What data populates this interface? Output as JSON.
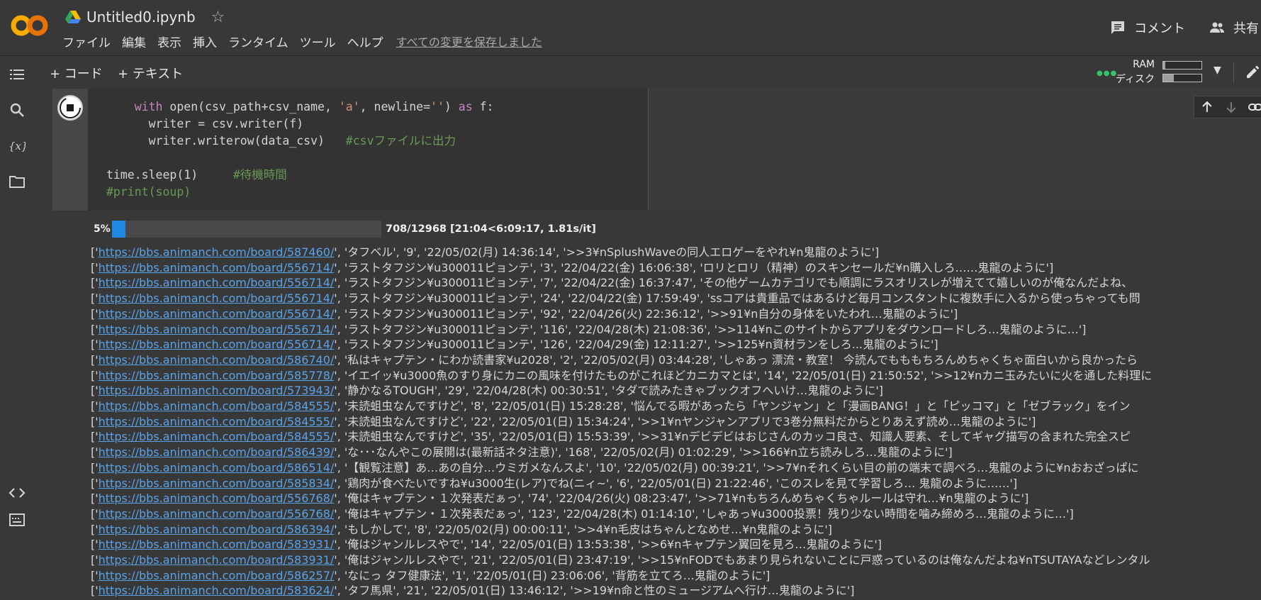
{
  "header": {
    "doc_title": "Untitled0.ipynb",
    "menu": [
      "ファイル",
      "編集",
      "表示",
      "挿入",
      "ランタイム",
      "ツール",
      "ヘルプ"
    ],
    "save_status": "すべての変更を保存しました",
    "comment_label": "コメント",
    "share_label": "共有"
  },
  "toolbar": {
    "add_code": "+ コード",
    "add_text": "+ テキスト",
    "ram_label": "RAM",
    "disk_label": "ディスク",
    "ram_fraction": 0.05,
    "disk_fraction": 0.28
  },
  "cell": {
    "code_lines": [
      {
        "indent": "    ",
        "parts": [
          [
            "kw",
            "with"
          ],
          [
            "",
            " open(csv_path+csv_name, "
          ],
          [
            "str",
            "'a'"
          ],
          [
            "",
            ", newline="
          ],
          [
            "str",
            "''"
          ],
          [
            "",
            ") "
          ],
          [
            "kw",
            "as"
          ],
          [
            "",
            " f:"
          ]
        ]
      },
      {
        "indent": "      ",
        "parts": [
          [
            "",
            "writer = csv.writer(f)"
          ]
        ]
      },
      {
        "indent": "      ",
        "parts": [
          [
            "",
            "writer.writerow(data_csv)   "
          ],
          [
            "cmt",
            "#csvファイルに出力"
          ]
        ]
      },
      {
        "indent": "",
        "parts": [
          [
            "",
            ""
          ]
        ]
      },
      {
        "indent": "",
        "parts": [
          [
            "",
            "time.sleep(1)     "
          ],
          [
            "cmt",
            "#待機時間"
          ]
        ]
      },
      {
        "indent": "",
        "parts": [
          [
            "cmt",
            "#print(soup)"
          ]
        ]
      }
    ]
  },
  "output": {
    "progress_percent": "5%",
    "progress_fraction": 0.05,
    "progress_stats": "708/12968 [21:04<6:09:17, 1.81s/it]",
    "lines": [
      {
        "url": "https://bbs.animanch.com/board/587460/",
        "rest": "', 'タフベル', '9', '22/05/02(月) 14:36:14', '>>3¥nSplushWaveの同人エロゲーをやれ¥n鬼龍のように']"
      },
      {
        "url": "https://bbs.animanch.com/board/556714/",
        "rest": "', 'ラストタフジン¥u300011ピョンテ', '3', '22/04/22(金) 16:06:38', 'ロリとロリ（精神）のスキンセールだ¥n購入しろ……鬼龍のように']"
      },
      {
        "url": "https://bbs.animanch.com/board/556714/",
        "rest": "', 'ラストタフジン¥u300011ピョンテ', '7', '22/04/22(金) 16:37:47', 'その他ゲームカテゴリでも順調にラスオリスレが増えてて嬉しいのが俺なんだよね、"
      },
      {
        "url": "https://bbs.animanch.com/board/556714/",
        "rest": "', 'ラストタフジン¥u300011ピョンテ', '24', '22/04/22(金) 17:59:49', 'ssコアは貴重品ではあるけど毎月コンスタントに複数手に入るから使っちゃっても問"
      },
      {
        "url": "https://bbs.animanch.com/board/556714/",
        "rest": "', 'ラストタフジン¥u300011ピョンテ', '92', '22/04/26(火) 22:36:12', '>>91¥n自分の身体をいたわれ…鬼龍のように']"
      },
      {
        "url": "https://bbs.animanch.com/board/556714/",
        "rest": "', 'ラストタフジン¥u300011ピョンテ', '116', '22/04/28(木) 21:08:36', '>>114¥nこのサイトからアプリをダウンロードしろ…鬼龍のように…']"
      },
      {
        "url": "https://bbs.animanch.com/board/556714/",
        "rest": "', 'ラストタフジン¥u300011ピョンテ', '126', '22/04/29(金) 12:11:27', '>>125¥n資材ランをしろ...鬼龍のように']"
      },
      {
        "url": "https://bbs.animanch.com/board/586740/",
        "rest": "', '私はキャプテン・にわか読書家¥u2028', '2', '22/05/02(月) 03:44:28', 'しゃあっ 漂流・教室！ 今読んでもももちろんめちゃくちゃ面白いから良かったら"
      },
      {
        "url": "https://bbs.animanch.com/board/585778/",
        "rest": "', 'イエイッ¥u3000魚のすり身にカニの風味を付けたものがこれほどカニカマとは', '14', '22/05/01(日) 21:50:52', '>>12¥nカニ玉みたいに火を通した料理に"
      },
      {
        "url": "https://bbs.animanch.com/board/573943/",
        "rest": "', '静かなるTOUGH', '29', '22/04/28(木) 00:30:51', 'タダで読みたきゃブックオフへいけ…鬼龍のように']"
      },
      {
        "url": "https://bbs.animanch.com/board/584555/",
        "rest": "', '未読蛆虫なんですけど', '8', '22/05/01(日) 15:28:28', '悩んでる暇があったら「ヤンジャン」と「漫画BANG！」と「ピッコマ」と「ゼブラック」をイン"
      },
      {
        "url": "https://bbs.animanch.com/board/584555/",
        "rest": "', '未読蛆虫なんですけど', '22', '22/05/01(日) 15:34:24', '>>1¥nヤンジャンアプリで3巻分無料だからとりあえず読め…鬼龍のように']"
      },
      {
        "url": "https://bbs.animanch.com/board/584555/",
        "rest": "', '未読蛆虫なんですけど', '35', '22/05/01(日) 15:53:39', '>>31¥nデビデビはおじさんのカッコ良さ、知識人要素、そしてギャグ描写の含まれた完全スピ"
      },
      {
        "url": "https://bbs.animanch.com/board/586439/",
        "rest": "', 'な･･･なんやこの展開は(最新話ネタ注意)', '168', '22/05/02(月) 01:02:29', '>>166¥n立ち読みしろ…鬼龍のように']"
      },
      {
        "url": "https://bbs.animanch.com/board/586514/",
        "rest": "', '【観覧注意】あ…あの自分…ウミガメなんスよ', '10', '22/05/02(月) 00:39:21', '>>7¥nそれくらい目の前の端末で調べろ…鬼龍のように¥nおおざっぱに"
      },
      {
        "url": "https://bbs.animanch.com/board/585834/",
        "rest": "', '鶏肉が食べたいですね¥u3000生(レア)でね(ニィ~', '6', '22/05/01(日) 21:22:46', 'このスレを見て学習しろ… 鬼龍のように……']"
      },
      {
        "url": "https://bbs.animanch.com/board/556768/",
        "rest": "', '俺はキャプテン・１次発表だぁっ', '74', '22/04/26(火) 08:23:47', '>>71¥nもちろんめちゃくちゃルールは守れ…¥n鬼龍のように']"
      },
      {
        "url": "https://bbs.animanch.com/board/556768/",
        "rest": "', '俺はキャプテン・１次発表だぁっ', '123', '22/04/28(木) 01:14:10', 'しゃあっ¥u3000投票！残り少ない時間を噛み締めろ…鬼龍のように…']"
      },
      {
        "url": "https://bbs.animanch.com/board/586394/",
        "rest": "', 'もしかして', '8', '22/05/02(月) 00:00:11', '>>4¥n毛皮はちゃんとなめせ…¥n鬼龍のように']"
      },
      {
        "url": "https://bbs.animanch.com/board/583931/",
        "rest": "', '俺はジャンルレスやで', '14', '22/05/01(日) 13:53:38', '>>6¥nキャプテン翼回を見ろ…鬼龍のように']"
      },
      {
        "url": "https://bbs.animanch.com/board/583931/",
        "rest": "', '俺はジャンルレスやで', '21', '22/05/01(日) 23:47:19', '>>15¥nFODでもあまり見られないことに戸惑っているのは俺なんだよね¥nTSUTAYAなどレンタル"
      },
      {
        "url": "https://bbs.animanch.com/board/586257/",
        "rest": "', 'なにっ タフ健康法', '1', '22/05/01(日) 23:06:06', '背筋を立てろ…鬼龍のように']"
      },
      {
        "url": "https://bbs.animanch.com/board/583624/",
        "rest": "', 'タフ馬県', '21', '22/05/01(日) 13:46:12', '>>19¥n命と性のミュージアムへ行け…鬼龍のように']"
      }
    ]
  },
  "colors": {
    "background": "#383838",
    "accent_blue": "#1e88e5",
    "link": "#5aa2e8",
    "status_green": "#36c36c",
    "logo_orange": "#f9ab00"
  },
  "icons": [
    "colab-logo",
    "drive-icon",
    "star-icon",
    "comment-icon",
    "share-icon",
    "toc-icon",
    "search-icon",
    "variables-icon",
    "files-icon",
    "code-snippets-icon",
    "terminal-icon",
    "stop-icon",
    "arrow-up-icon",
    "arrow-down-icon",
    "link-icon",
    "comment-icon",
    "gear-icon",
    "edit-icon"
  ]
}
